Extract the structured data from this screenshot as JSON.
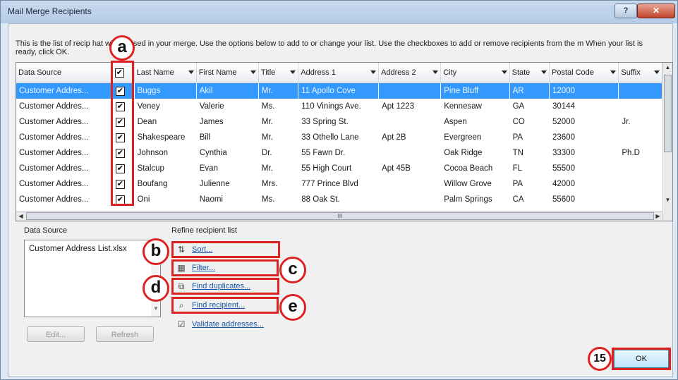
{
  "window": {
    "title": "Mail Merge Recipients",
    "help_label": "?",
    "close_label": "✕"
  },
  "intro_text": "This is the list of recip        hat will be used in your merge.  Use the options below to add to or change your list.  Use the checkboxes to add or remove recipients from the m          When your list is ready, click OK.",
  "table": {
    "columns": [
      "Data Source",
      "",
      "Last Name",
      "First Name",
      "Title",
      "Address 1",
      "Address 2",
      "City",
      "State",
      "Postal Code",
      "Suffix"
    ],
    "rows": [
      {
        "source": "Customer Addres...",
        "check": "✔",
        "last": "Buggs",
        "first": "Akil",
        "title": "Mr.",
        "addr1": "11 Apollo Cove",
        "addr2": "",
        "city": "Pine Bluff",
        "state": "AR",
        "postal": "12000",
        "suffix": ""
      },
      {
        "source": "Customer Addres...",
        "check": "✔",
        "last": "Veney",
        "first": "Valerie",
        "title": "Ms.",
        "addr1": "110 Vinings Ave.",
        "addr2": "Apt 1223",
        "city": "Kennesaw",
        "state": "GA",
        "postal": "30144",
        "suffix": ""
      },
      {
        "source": "Customer Addres...",
        "check": "✔",
        "last": "Dean",
        "first": "James",
        "title": "Mr.",
        "addr1": "33 Spring St.",
        "addr2": "",
        "city": "Aspen",
        "state": "CO",
        "postal": "52000",
        "suffix": "Jr."
      },
      {
        "source": "Customer Addres...",
        "check": "✔",
        "last": "Shakespeare",
        "first": "Bill",
        "title": "Mr.",
        "addr1": "33 Othello Lane",
        "addr2": "Apt 2B",
        "city": "Evergreen",
        "state": "PA",
        "postal": "23600",
        "suffix": ""
      },
      {
        "source": "Customer Addres...",
        "check": "✔",
        "last": "Johnson",
        "first": "Cynthia",
        "title": "Dr.",
        "addr1": "55 Fawn Dr.",
        "addr2": "",
        "city": "Oak Ridge",
        "state": "TN",
        "postal": "33300",
        "suffix": "Ph.D"
      },
      {
        "source": "Customer Addres...",
        "check": "✔",
        "last": "Stalcup",
        "first": "Evan",
        "title": "Mr.",
        "addr1": "55 High Court",
        "addr2": "Apt 45B",
        "city": "Cocoa Beach",
        "state": "FL",
        "postal": "55500",
        "suffix": ""
      },
      {
        "source": "Customer Addres...",
        "check": "✔",
        "last": "Boufang",
        "first": "Julienne",
        "title": "Mrs.",
        "addr1": "777 Prince Blvd",
        "addr2": "",
        "city": "Willow Grove",
        "state": "PA",
        "postal": "42000",
        "suffix": ""
      },
      {
        "source": "Customer Addres...",
        "check": "✔",
        "last": "Oni",
        "first": "Naomi",
        "title": "Ms.",
        "addr1": "88 Oak St.",
        "addr2": "",
        "city": "Palm Springs",
        "state": "CA",
        "postal": "55600",
        "suffix": ""
      }
    ]
  },
  "data_source": {
    "label": "Data Source",
    "file": "Customer Address List.xlsx",
    "edit_label": "Edit...",
    "refresh_label": "Refresh"
  },
  "refine": {
    "label": "Refine recipient list",
    "sort": "Sort...",
    "filter": "Filter...",
    "find_duplicates": "Find duplicates...",
    "find_recipient": "Find recipient...",
    "validate": "Validate addresses..."
  },
  "ok_label": "OK",
  "callouts": {
    "a": "a",
    "b": "b",
    "c": "c",
    "d": "d",
    "e": "e",
    "step": "15"
  },
  "colors": {
    "highlight": "#dd2222",
    "selection": "#3399ff"
  }
}
